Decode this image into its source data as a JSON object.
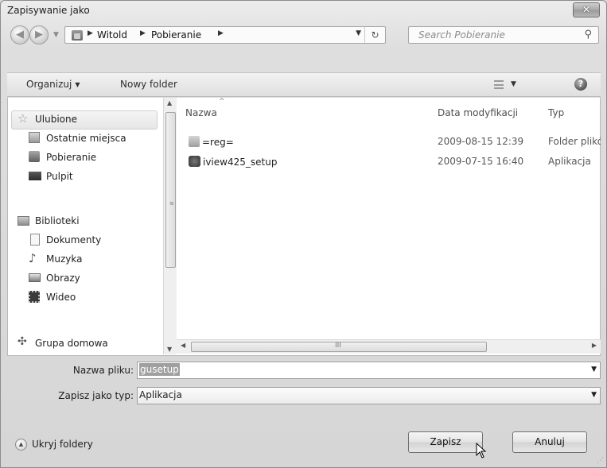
{
  "window": {
    "title": "Zapisywanie jako",
    "close_glyph": "✕"
  },
  "nav": {
    "back_glyph": "◀",
    "forward_glyph": "▶",
    "breadcrumb": [
      "Witold",
      "Pobieranie"
    ],
    "sep": "▶",
    "search_placeholder": "Search Pobieranie"
  },
  "toolbar": {
    "organize_label": "Organizuj",
    "new_folder_label": "Nowy folder"
  },
  "navpane": {
    "favorites": [
      {
        "label": "Ulubione",
        "icon": "star-icon"
      },
      {
        "label": "Ostatnie miejsca",
        "icon": "recent-places-icon"
      },
      {
        "label": "Pobieranie",
        "icon": "downloads-folder-icon"
      },
      {
        "label": "Pulpit",
        "icon": "desktop-icon"
      }
    ],
    "libraries": [
      {
        "label": "Biblioteki",
        "icon": "libraries-icon"
      },
      {
        "label": "Dokumenty",
        "icon": "documents-icon"
      },
      {
        "label": "Muzyka",
        "icon": "music-icon"
      },
      {
        "label": "Obrazy",
        "icon": "pictures-icon"
      },
      {
        "label": "Wideo",
        "icon": "video-icon"
      }
    ],
    "homegroup": {
      "label": "Grupa domowa",
      "icon": "homegroup-icon"
    }
  },
  "files": {
    "columns": {
      "name": "Nazwa",
      "date": "Data modyfikacji",
      "type": "Typ"
    },
    "rows": [
      {
        "name": "=reg=",
        "date": "2009-08-15 12:39",
        "type": "Folder plików",
        "icon": "folder-icon"
      },
      {
        "name": "iview425_setup",
        "date": "2009-07-15 16:40",
        "type": "Aplikacja",
        "icon": "application-icon"
      }
    ]
  },
  "form": {
    "filename_label": "Nazwa pliku:",
    "filename_value": "gusetup",
    "filetype_label": "Zapisz jako typ:",
    "filetype_value": "Aplikacja"
  },
  "footer": {
    "hide_folders_label": "Ukryj foldery",
    "save_label": "Zapisz",
    "cancel_label": "Anuluj"
  }
}
